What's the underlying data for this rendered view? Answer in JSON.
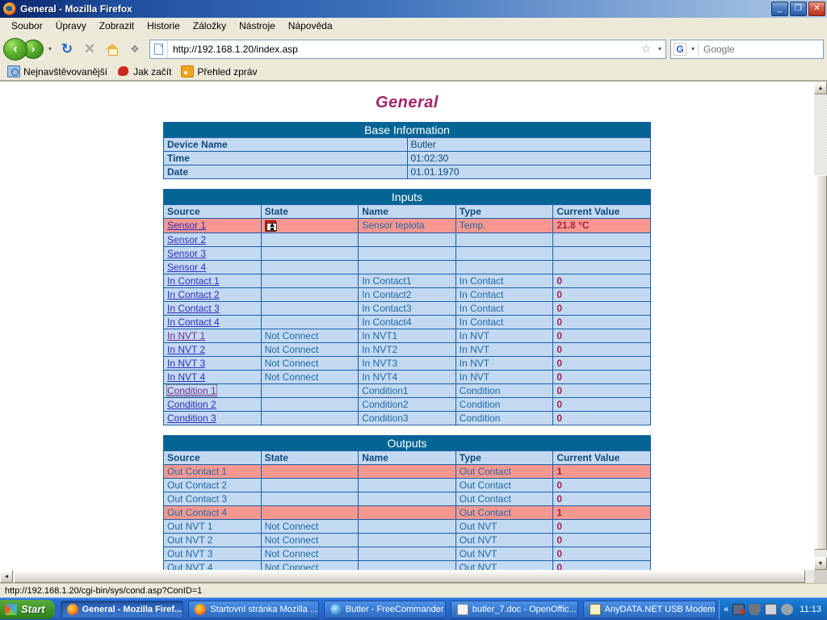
{
  "window": {
    "title": "General - Mozilla Firefox",
    "minimize_label": "_",
    "restore_label": "❐",
    "close_label": "✕"
  },
  "menu": {
    "items": [
      {
        "label": "Soubor"
      },
      {
        "label": "Úpravy"
      },
      {
        "label": "Zobrazit"
      },
      {
        "label": "Historie"
      },
      {
        "label": "Záložky"
      },
      {
        "label": "Nástroje"
      },
      {
        "label": "Nápověda"
      }
    ]
  },
  "nav": {
    "back_label": "‹",
    "forward_label": "›",
    "dropdown_label": "▾",
    "reload_label": "↻",
    "stop_label": "✕",
    "home_icon": "home-icon",
    "feed_icon": "feed-icon",
    "url_value": "http://192.168.1.20/index.asp",
    "url_placeholder": "",
    "bookmark_star": "☆",
    "url_dropdown": "▾",
    "search_engine": "G",
    "search_dropdown": "▾",
    "search_placeholder": "Google",
    "search_value": "",
    "search_go": "⚲"
  },
  "bookmarks": {
    "items": [
      {
        "label": "Nejnavštěvovanější",
        "icon": "folder-search-icon"
      },
      {
        "label": "Jak začít",
        "icon": "horse-icon"
      },
      {
        "label": "Přehled zpráv",
        "icon": "rss-icon"
      }
    ]
  },
  "page": {
    "title": "General",
    "base_information": {
      "caption": "Base Information",
      "rows": [
        {
          "label": "Device Name",
          "value": "Butler"
        },
        {
          "label": "Time",
          "value": "01:02:30"
        },
        {
          "label": "Date",
          "value": "01.01.1970"
        }
      ]
    },
    "inputs": {
      "caption": "Inputs",
      "columns": [
        "Source",
        "State",
        "Name",
        "Type",
        "Current Value"
      ],
      "rows": [
        {
          "source": "Sensor 1",
          "link": true,
          "link_state": "normal",
          "state": "",
          "state_icon": "alarm-up-icon",
          "name": "Sensor teplota",
          "type": "Temp.",
          "value": "21.8 °C",
          "alarm": true
        },
        {
          "source": "Sensor 2",
          "link": true,
          "link_state": "normal",
          "state": "",
          "state_icon": "",
          "name": "",
          "type": "",
          "value": "",
          "alarm": false
        },
        {
          "source": "Sensor 3",
          "link": true,
          "link_state": "normal",
          "state": "",
          "state_icon": "",
          "name": "",
          "type": "",
          "value": "",
          "alarm": false
        },
        {
          "source": "Sensor 4",
          "link": true,
          "link_state": "normal",
          "state": "",
          "state_icon": "",
          "name": "",
          "type": "",
          "value": "",
          "alarm": false
        },
        {
          "source": "In Contact 1",
          "link": true,
          "link_state": "normal",
          "state": "",
          "state_icon": "",
          "name": "In Contact1",
          "type": "In Contact",
          "value": "0",
          "alarm": false
        },
        {
          "source": "In Contact 2",
          "link": true,
          "link_state": "normal",
          "state": "",
          "state_icon": "",
          "name": "In Contact2",
          "type": "In Contact",
          "value": "0",
          "alarm": false
        },
        {
          "source": "In Contact 3",
          "link": true,
          "link_state": "normal",
          "state": "",
          "state_icon": "",
          "name": "In Contact3",
          "type": "In Contact",
          "value": "0",
          "alarm": false
        },
        {
          "source": "In Contact 4",
          "link": true,
          "link_state": "normal",
          "state": "",
          "state_icon": "",
          "name": "In Contact4",
          "type": "In Contact",
          "value": "0",
          "alarm": false
        },
        {
          "source": "In NVT 1",
          "link": true,
          "link_state": "visited",
          "state": "Not Connect",
          "state_icon": "",
          "name": "In NVT1",
          "type": "In NVT",
          "value": "0",
          "alarm": false
        },
        {
          "source": "In NVT 2",
          "link": true,
          "link_state": "normal",
          "state": "Not Connect",
          "state_icon": "",
          "name": "In NVT2",
          "type": "In NVT",
          "value": "0",
          "alarm": false
        },
        {
          "source": "In NVT 3",
          "link": true,
          "link_state": "normal",
          "state": "Not Connect",
          "state_icon": "",
          "name": "In NVT3",
          "type": "In NVT",
          "value": "0",
          "alarm": false
        },
        {
          "source": "In NVT 4",
          "link": true,
          "link_state": "normal",
          "state": "Not Connect",
          "state_icon": "",
          "name": "In NVT4",
          "type": "In NVT",
          "value": "0",
          "alarm": false
        },
        {
          "source": "Condition 1",
          "link": true,
          "link_state": "focused",
          "state": "",
          "state_icon": "",
          "name": "Condition1",
          "type": "Condition",
          "value": "0",
          "alarm": false
        },
        {
          "source": "Condition 2",
          "link": true,
          "link_state": "normal",
          "state": "",
          "state_icon": "",
          "name": "Condition2",
          "type": "Condition",
          "value": "0",
          "alarm": false
        },
        {
          "source": "Condition 3",
          "link": true,
          "link_state": "normal",
          "state": "",
          "state_icon": "",
          "name": "Condition3",
          "type": "Condition",
          "value": "0",
          "alarm": false
        }
      ]
    },
    "outputs": {
      "caption": "Outputs",
      "columns": [
        "Source",
        "State",
        "Name",
        "Type",
        "Current Value"
      ],
      "rows": [
        {
          "source": "Out Contact 1",
          "link": false,
          "link_state": "",
          "state": "",
          "state_icon": "",
          "name": "",
          "type": "Out Contact",
          "value": "1",
          "alarm": true
        },
        {
          "source": "Out Contact 2",
          "link": false,
          "link_state": "",
          "state": "",
          "state_icon": "",
          "name": "",
          "type": "Out Contact",
          "value": "0",
          "alarm": false
        },
        {
          "source": "Out Contact 3",
          "link": false,
          "link_state": "",
          "state": "",
          "state_icon": "",
          "name": "",
          "type": "Out Contact",
          "value": "0",
          "alarm": false
        },
        {
          "source": "Out Contact 4",
          "link": false,
          "link_state": "",
          "state": "",
          "state_icon": "",
          "name": "",
          "type": "Out Contact",
          "value": "1",
          "alarm": true
        },
        {
          "source": "Out NVT 1",
          "link": false,
          "link_state": "",
          "state": "Not Connect",
          "state_icon": "",
          "name": "",
          "type": "Out NVT",
          "value": "0",
          "alarm": false
        },
        {
          "source": "Out NVT 2",
          "link": false,
          "link_state": "",
          "state": "Not Connect",
          "state_icon": "",
          "name": "",
          "type": "Out NVT",
          "value": "0",
          "alarm": false
        },
        {
          "source": "Out NVT 3",
          "link": false,
          "link_state": "",
          "state": "Not Connect",
          "state_icon": "",
          "name": "",
          "type": "Out NVT",
          "value": "0",
          "alarm": false
        },
        {
          "source": "Out NVT 4",
          "link": false,
          "link_state": "",
          "state": "Not Connect",
          "state_icon": "",
          "name": "",
          "type": "Out NVT",
          "value": "0",
          "alarm": false
        }
      ]
    }
  },
  "scrollbars": {
    "up_arrow": "▲",
    "down_arrow": "▼",
    "left_arrow": "◄",
    "right_arrow": "►"
  },
  "statusbar": {
    "text": "http://192.168.1.20/cgi-bin/sys/cond.asp?ConID=1"
  },
  "taskbar": {
    "start_label": "Start",
    "items": [
      {
        "label": "General - Mozilla Firef...",
        "icon": "firefox-icon",
        "active": true
      },
      {
        "label": "Startovní stránka Mozilla ...",
        "icon": "firefox-icon",
        "active": false
      },
      {
        "label": "Butler - FreeCommander",
        "icon": "freecommander-icon",
        "active": false
      },
      {
        "label": "butler_7.doc - OpenOffic...",
        "icon": "openoffice-icon",
        "active": false
      },
      {
        "label": "AnyDATA.NET USB Modem",
        "icon": "modem-icon",
        "active": false
      }
    ],
    "tray": {
      "expand_label": "«",
      "icons": [
        "network-disconnected-icon",
        "shield-icon",
        "monitor-icon",
        "speaker-icon"
      ],
      "clock": "11:13"
    }
  },
  "colors": {
    "table_header": "#046595",
    "row_normal": "#c3d9f2",
    "row_alarm": "#f79890",
    "value_text": "#a32449",
    "page_title": "#a2266b",
    "link": "#2f2fbf",
    "link_visited": "#7a2d8c"
  }
}
